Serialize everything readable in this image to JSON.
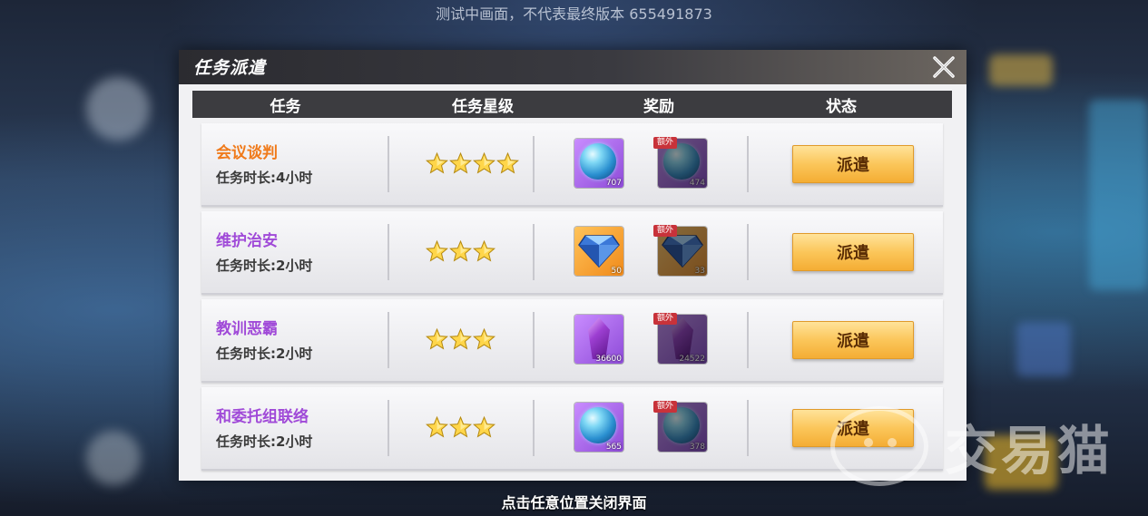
{
  "top_watermark": "测试中画面，不代表最终版本 655491873",
  "close_hint": "点击任意位置关闭界面",
  "brand_watermark": "交易猫",
  "dialog": {
    "title": "任务派遣",
    "close_icon": "close-icon"
  },
  "columns": [
    "任务",
    "任务星级",
    "奖励",
    "状态"
  ],
  "extra_tag_label": "额外",
  "colors": {
    "task_orange": "#f07a1a",
    "task_purple": "#a04ad8",
    "header_bg": "#3c3c40",
    "button_gold": "#fbc65a"
  },
  "tasks": [
    {
      "name": "会议谈判",
      "name_color": "#f07a1a",
      "duration": "任务时长:4小时",
      "stars": 4,
      "reward": {
        "icon": "blue-orb-icon",
        "qty": "707"
      },
      "extra_reward": {
        "icon": "blue-orb-icon",
        "qty": "474"
      },
      "action": "派遣"
    },
    {
      "name": "维护治安",
      "name_color": "#a04ad8",
      "duration": "任务时长:2小时",
      "stars": 3,
      "reward": {
        "icon": "blue-diamond-icon",
        "qty": "50"
      },
      "extra_reward": {
        "icon": "blue-diamond-icon",
        "qty": "33"
      },
      "action": "派遣"
    },
    {
      "name": "教训恶霸",
      "name_color": "#a04ad8",
      "duration": "任务时长:2小时",
      "stars": 3,
      "reward": {
        "icon": "purple-crystal-icon",
        "qty": "36600"
      },
      "extra_reward": {
        "icon": "purple-crystal-icon",
        "qty": "24522"
      },
      "action": "派遣"
    },
    {
      "name": "和委托组联络",
      "name_color": "#a04ad8",
      "duration": "任务时长:2小时",
      "stars": 3,
      "reward": {
        "icon": "blue-orb-icon",
        "qty": "565"
      },
      "extra_reward": {
        "icon": "blue-orb-icon",
        "qty": "378"
      },
      "action": "派遣"
    }
  ]
}
